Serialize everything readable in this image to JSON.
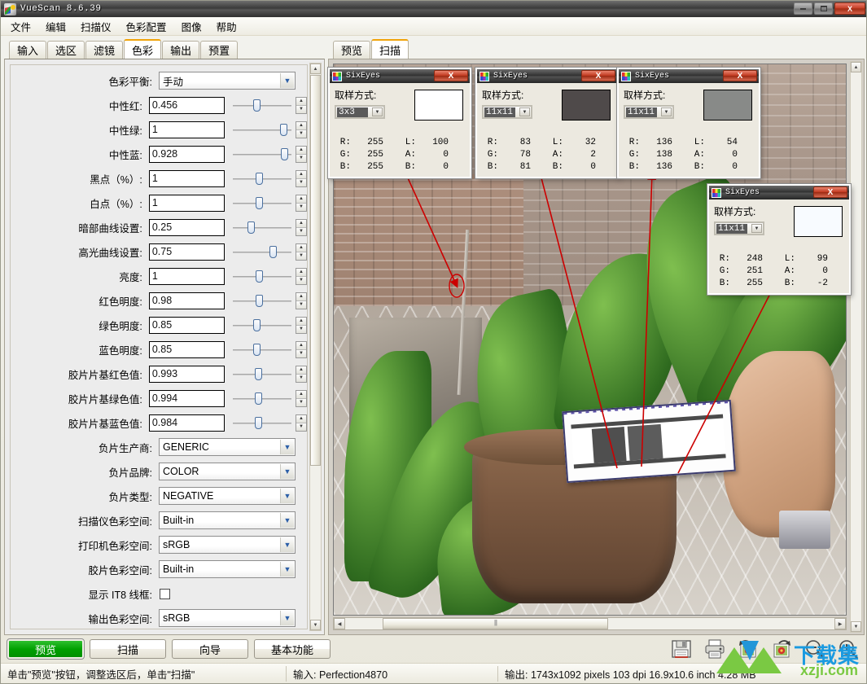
{
  "window": {
    "title": "VueScan 8.6.39",
    "icon": "vuescan-logo-icon",
    "minimize_label": "–",
    "maximize_label": "□",
    "close_label": "X"
  },
  "menu": {
    "items": [
      "文件",
      "编辑",
      "扫描仪",
      "色彩配置",
      "图像",
      "帮助"
    ]
  },
  "left_tabs": {
    "items": [
      "输入",
      "选区",
      "滤镜",
      "色彩",
      "输出",
      "预置"
    ],
    "active": "色彩"
  },
  "right_tabs": {
    "items": [
      "预览",
      "扫描"
    ],
    "active": "扫描"
  },
  "color_panel": {
    "rows": [
      {
        "label": "色彩平衡:",
        "type": "combo",
        "value": "手动"
      },
      {
        "label": "中性红:",
        "type": "number",
        "value": "0.456",
        "slider": 40
      },
      {
        "label": "中性绿:",
        "type": "number",
        "value": "1",
        "slider": 92
      },
      {
        "label": "中性蓝:",
        "type": "number",
        "value": "0.928",
        "slider": 93
      },
      {
        "label": "黑点（%）:",
        "type": "number",
        "value": "1",
        "slider": 45
      },
      {
        "label": "白点（%）:",
        "type": "number",
        "value": "1",
        "slider": 45
      },
      {
        "label": "暗部曲线设置:",
        "type": "number",
        "value": "0.25",
        "slider": 28
      },
      {
        "label": "高光曲线设置:",
        "type": "number",
        "value": "0.75",
        "slider": 72
      },
      {
        "label": "亮度:",
        "type": "number",
        "value": "1",
        "slider": 45
      },
      {
        "label": "红色明度:",
        "type": "number",
        "value": "0.98",
        "slider": 45
      },
      {
        "label": "绿色明度:",
        "type": "number",
        "value": "0.85",
        "slider": 40
      },
      {
        "label": "蓝色明度:",
        "type": "number",
        "value": "0.85",
        "slider": 40
      },
      {
        "label": "胶片片基红色值:",
        "type": "number",
        "value": "0.993",
        "slider": 43
      },
      {
        "label": "胶片片基绿色值:",
        "type": "number",
        "value": "0.994",
        "slider": 43
      },
      {
        "label": "胶片片基蓝色值:",
        "type": "number",
        "value": "0.984",
        "slider": 43
      },
      {
        "label": "负片生产商:",
        "type": "combo",
        "value": "GENERIC"
      },
      {
        "label": "负片品牌:",
        "type": "combo",
        "value": "COLOR"
      },
      {
        "label": "负片类型:",
        "type": "combo",
        "value": "NEGATIVE"
      },
      {
        "label": "扫描仪色彩空间:",
        "type": "combo",
        "value": "Built-in"
      },
      {
        "label": "打印机色彩空间:",
        "type": "combo",
        "value": "sRGB"
      },
      {
        "label": "胶片色彩空间:",
        "type": "combo",
        "value": "Built-in"
      },
      {
        "label": "显示 IT8 线框:",
        "type": "checkbox",
        "value": ""
      },
      {
        "label": "输出色彩空间:",
        "type": "combo",
        "value": "sRGB"
      }
    ]
  },
  "sixeyes": {
    "title": "SixEyes",
    "close_label": "X",
    "sample_label": "取样方式:",
    "keys": [
      "R:",
      "G:",
      "B:"
    ],
    "lab_keys": [
      "L:",
      "A:",
      "B:"
    ],
    "windows": [
      {
        "id": "sixeyes-window-1",
        "sample_mode": "3x3",
        "swatch_color": "#ffffff",
        "rgb": [
          "255",
          "255",
          "255"
        ],
        "lab": [
          "100",
          "0",
          "0"
        ]
      },
      {
        "id": "sixeyes-window-2",
        "sample_mode": "11x11",
        "swatch_color": "#4f4a4a",
        "rgb": [
          "83",
          "78",
          "81"
        ],
        "lab": [
          "32",
          "2",
          "0"
        ]
      },
      {
        "id": "sixeyes-window-3",
        "sample_mode": "11x11",
        "swatch_color": "#888a88",
        "rgb": [
          "136",
          "138",
          "136"
        ],
        "lab": [
          "54",
          "0",
          "0"
        ]
      },
      {
        "id": "sixeyes-window-4",
        "sample_mode": "11x11",
        "swatch_color": "#f8fbff",
        "rgb": [
          "248",
          "251",
          "255"
        ],
        "lab": [
          "99",
          "0",
          "-2"
        ]
      }
    ]
  },
  "action_buttons": [
    {
      "label": "预览",
      "style": "green"
    },
    {
      "label": "扫描",
      "style": "normal"
    },
    {
      "label": "向导",
      "style": "normal"
    },
    {
      "label": "基本功能",
      "style": "normal"
    }
  ],
  "toolbar_icons": [
    "save-icon",
    "print-icon",
    "rotate-left-icon",
    "rotate-right-icon",
    "zoom-out-icon",
    "zoom-in-icon"
  ],
  "status": {
    "hint": "单击\"预览\"按钮，调整选区后，单击\"扫描\"",
    "input": "输入: Perfection4870",
    "output": "输出: 1743x1092 pixels 103 dpi 16.9x10.6 inch 4.28 MB"
  },
  "watermark": {
    "main": "下载集",
    "sub": "xzji.com"
  },
  "colors": {
    "accent_tab": "#f0a30a",
    "preview_green": "#00a000",
    "titlebar_dark": "#2f2f2f",
    "close_red": "#c23b22",
    "annotation_arrow": "#cc0000"
  }
}
